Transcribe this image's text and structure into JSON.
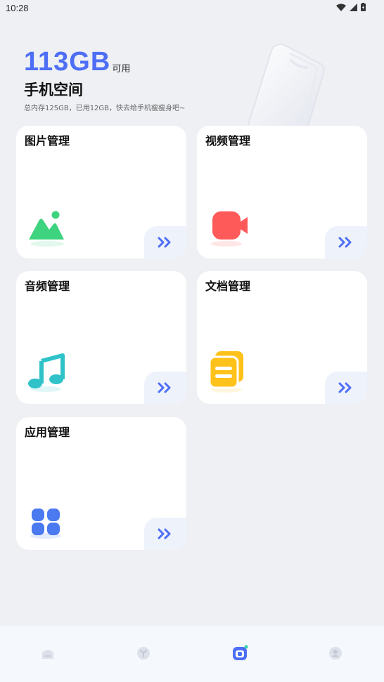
{
  "status_bar": {
    "time": "10:28"
  },
  "storage": {
    "free_value": "113GB",
    "free_unit": "可用",
    "title": "手机空间",
    "description": "总内存125GB，已用12GB，快去给手机瘦瘦身吧~"
  },
  "categories": [
    {
      "title": "图片管理",
      "icon": "image-icon",
      "color": "#3ed37e"
    },
    {
      "title": "视频管理",
      "icon": "video-camera-icon",
      "color": "#ff5a5a"
    },
    {
      "title": "音频管理",
      "icon": "music-note-icon",
      "color": "#2fc3c9"
    },
    {
      "title": "文档管理",
      "icon": "document-icon",
      "color": "#ffc21a"
    },
    {
      "title": "应用管理",
      "icon": "apps-icon",
      "color": "#4a79f0"
    }
  ],
  "accent_color": "#4d6ef5",
  "bottom_nav": [
    {
      "icon": "home-icon",
      "active": false
    },
    {
      "icon": "clean-icon",
      "active": false
    },
    {
      "icon": "storage-manager-icon",
      "active": true
    },
    {
      "icon": "profile-icon",
      "active": false
    }
  ]
}
